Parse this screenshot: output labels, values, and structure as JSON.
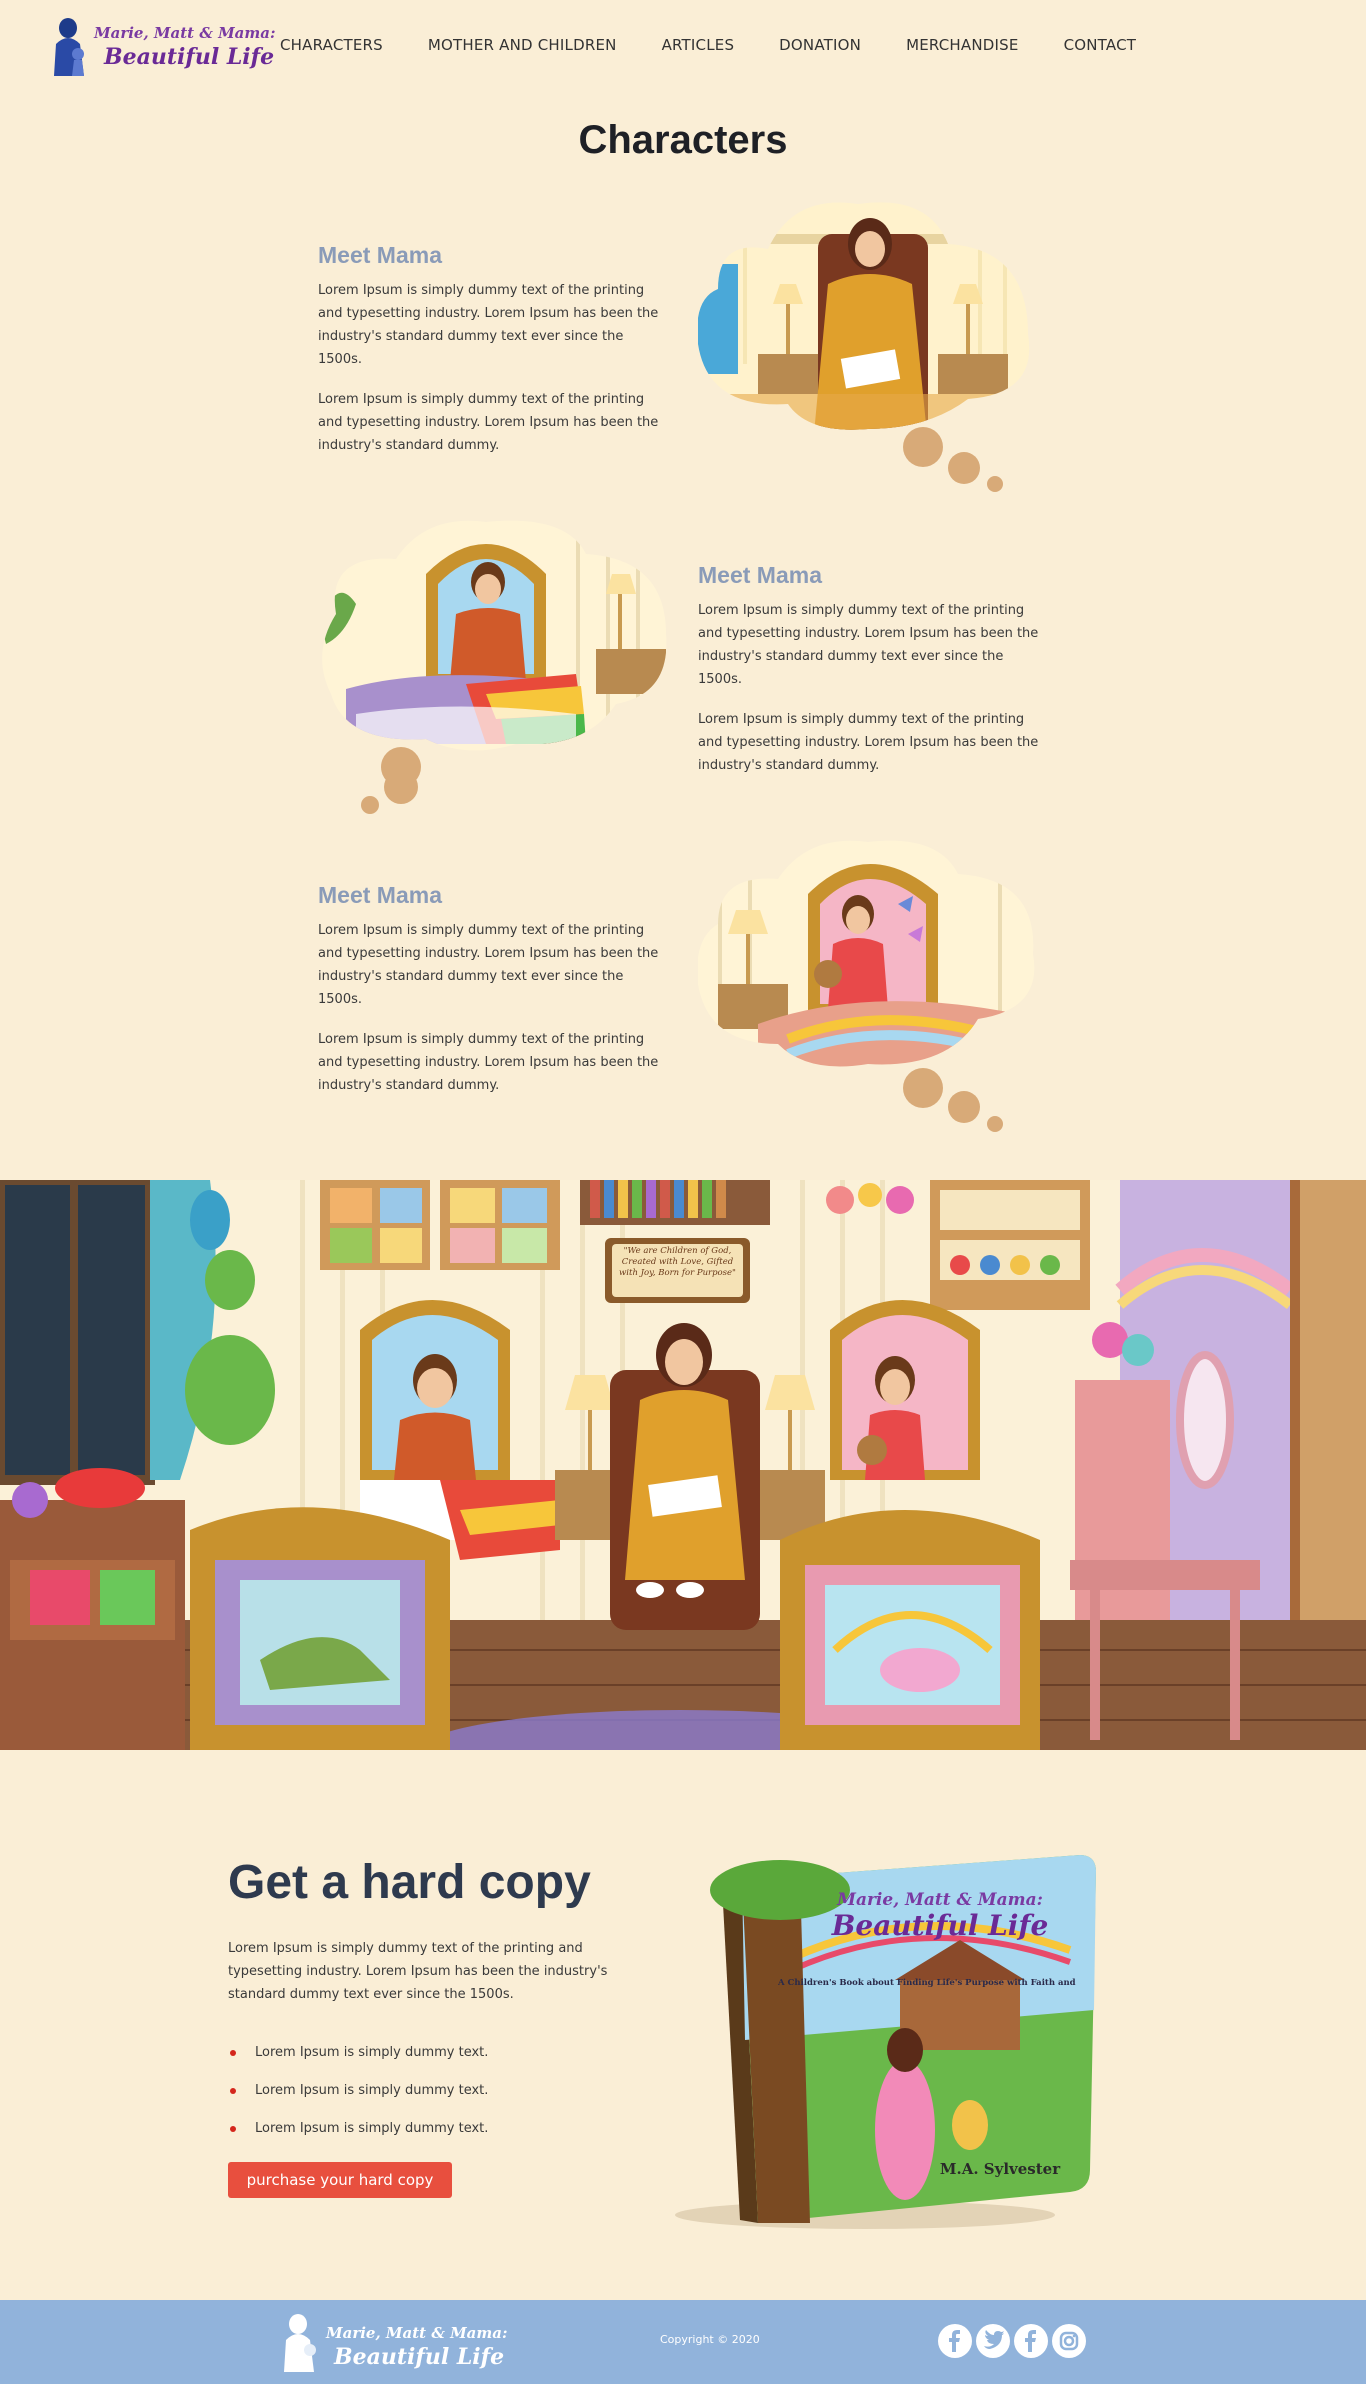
{
  "brand": {
    "line1": "Marie, Matt & Mama:",
    "line2": "Beautiful Life"
  },
  "nav": {
    "items": [
      "CHARACTERS",
      "MOTHER AND CHILDREN",
      "ARTICLES",
      "DONATION",
      "MERCHANDISE",
      "CONTACT"
    ]
  },
  "page_title": "Characters",
  "characters": [
    {
      "heading": "Meet Mama",
      "p1": "Lorem Ipsum is simply dummy text of the printing and typesetting industry. Lorem Ipsum has been the industry's standard dummy text ever since the 1500s.",
      "p2": "Lorem Ipsum is simply dummy text of the printing and typesetting industry. Lorem Ipsum has been the industry's standard dummy."
    },
    {
      "heading": "Meet Mama",
      "p1": "Lorem Ipsum is simply dummy text of the printing and typesetting industry. Lorem Ipsum has been the industry's standard dummy text ever since the 1500s.",
      "p2": "Lorem Ipsum is simply dummy text of the printing and typesetting industry. Lorem Ipsum has been the industry's standard dummy."
    },
    {
      "heading": "Meet Mama",
      "p1": "Lorem Ipsum is simply dummy text of the printing and typesetting industry. Lorem Ipsum has been the industry's standard dummy text ever since the 1500s.",
      "p2": "Lorem Ipsum is simply dummy text of the printing and typesetting industry. Lorem Ipsum has been the industry's standard dummy."
    }
  ],
  "banner": {
    "sign_text": "\"We are Children of God, Created with Love, Gifted with Joy, Born for Purpose\""
  },
  "hard_copy": {
    "title": "Get a hard copy",
    "description": "Lorem Ipsum is simply dummy text of the printing and typesetting industry. Lorem Ipsum has been the industry's standard dummy text ever since the 1500s.",
    "bullets": [
      "Lorem Ipsum is simply dummy text.",
      "Lorem Ipsum is simply dummy text.",
      "Lorem Ipsum is simply dummy text."
    ],
    "button": "purchase your hard copy"
  },
  "book": {
    "title1": "Marie, Matt & Mama:",
    "title2": "Beautiful Life",
    "subtitle": "A Children's Book about Finding Life's Purpose with Faith and Love",
    "author": "M.A. Sylvester"
  },
  "footer": {
    "copyright": "Copyright © 2020",
    "social": [
      "facebook-icon",
      "twitter-icon",
      "facebook-icon",
      "instagram-icon"
    ]
  },
  "colors": {
    "background": "#faeed6",
    "heading_blue": "#8a9bb8",
    "button_red": "#e84f3e",
    "footer_blue": "#91b3db",
    "brand_purple": "#6a2a96"
  }
}
